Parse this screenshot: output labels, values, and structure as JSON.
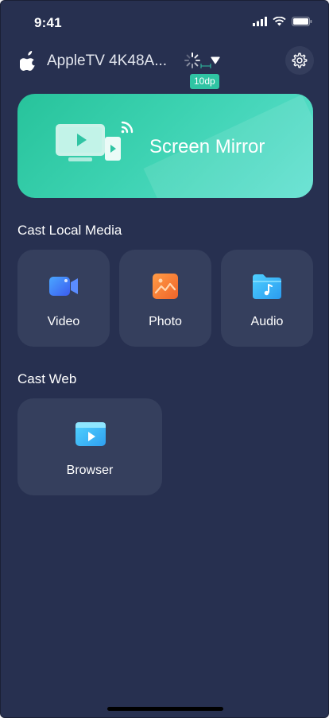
{
  "status_bar": {
    "time": "9:41"
  },
  "header": {
    "device_name": "AppleTV 4K48A...",
    "dp_badge": "10dp"
  },
  "mirror": {
    "label": "Screen Mirror"
  },
  "local_media": {
    "title": "Cast Local Media",
    "items": [
      {
        "label": "Video",
        "icon": "video-camera-icon"
      },
      {
        "label": "Photo",
        "icon": "photo-icon"
      },
      {
        "label": "Audio",
        "icon": "audio-folder-icon"
      }
    ]
  },
  "web": {
    "title": "Cast Web",
    "items": [
      {
        "label": "Browser",
        "icon": "browser-icon"
      }
    ]
  },
  "colors": {
    "background": "#273050",
    "tile": "#353f5d",
    "accent_green": "#2fc4a3"
  }
}
